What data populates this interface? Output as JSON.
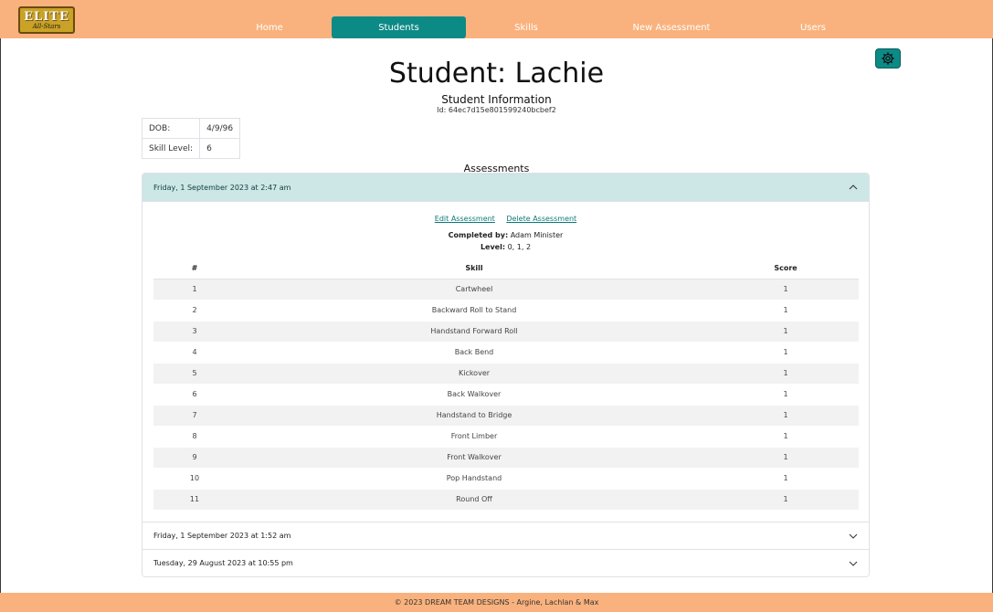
{
  "brand": {
    "logo_main": "ELITE",
    "logo_sub": "All-Stars"
  },
  "nav": {
    "items": [
      {
        "label": "Home"
      },
      {
        "label": "Students"
      },
      {
        "label": "Skills"
      },
      {
        "label": "New Assessment"
      },
      {
        "label": "Users"
      }
    ],
    "active": "Students"
  },
  "settings_icon": "gear-icon",
  "page": {
    "title": "Student: Lachie",
    "subtitle": "Student Information",
    "id_text": "Id: 64ec7d15e801599240bcbef2"
  },
  "info": {
    "dob_label": "DOB:",
    "dob_value": "4/9/96",
    "skill_label": "Skill Level:",
    "skill_value": "6"
  },
  "assessments": {
    "title": "Assessments",
    "items": [
      {
        "date": "Friday, 1 September 2023 at 2:47 am",
        "expanded": true
      },
      {
        "date": "Friday, 1 September 2023 at 1:52 am",
        "expanded": false
      },
      {
        "date": "Tuesday, 29 August 2023 at 10:55 pm",
        "expanded": false
      }
    ],
    "open": {
      "edit_label": "Edit Assessment",
      "delete_label": "Delete Assessment",
      "completed_label": "Completed by:",
      "completed_value": "Adam Minister",
      "level_label": "Level:",
      "level_value": "0, 1, 2",
      "headers": {
        "num": "#",
        "skill": "Skill",
        "score": "Score"
      },
      "rows": [
        {
          "num": "1",
          "skill": "Cartwheel",
          "score": "1"
        },
        {
          "num": "2",
          "skill": "Backward Roll to Stand",
          "score": "1"
        },
        {
          "num": "3",
          "skill": "Handstand Forward Roll",
          "score": "1"
        },
        {
          "num": "4",
          "skill": "Back Bend",
          "score": "1"
        },
        {
          "num": "5",
          "skill": "Kickover",
          "score": "1"
        },
        {
          "num": "6",
          "skill": "Back Walkover",
          "score": "1"
        },
        {
          "num": "7",
          "skill": "Handstand to Bridge",
          "score": "1"
        },
        {
          "num": "8",
          "skill": "Front Limber",
          "score": "1"
        },
        {
          "num": "9",
          "skill": "Front Walkover",
          "score": "1"
        },
        {
          "num": "10",
          "skill": "Pop Handstand",
          "score": "1"
        },
        {
          "num": "11",
          "skill": "Round Off",
          "score": "1"
        }
      ]
    }
  },
  "footer": {
    "text": "© 2023 DREAM TEAM DESIGNS - Argine, Lachlan & Max"
  },
  "colors": {
    "nav_bg": "#f9b27d",
    "accent": "#0c8a86",
    "accordion_open": "#cde6e6"
  }
}
